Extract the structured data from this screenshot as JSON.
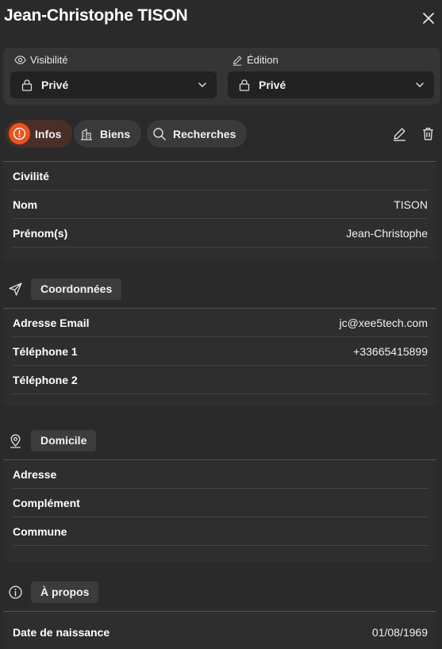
{
  "header": {
    "title": "Jean-Christophe TISON",
    "close_icon": "close-icon"
  },
  "visibility": {
    "visibilite_label": "Visibilité",
    "visibilite_value": "Privé",
    "edition_label": "Édition",
    "edition_value": "Privé"
  },
  "tabs": [
    {
      "label": "Infos",
      "icon": "info-icon",
      "active": true
    },
    {
      "label": "Biens",
      "icon": "building-icon",
      "active": false
    },
    {
      "label": "Recherches",
      "icon": "search-icon",
      "active": false
    }
  ],
  "identity": {
    "rows": [
      {
        "key": "Civilité",
        "value": ""
      },
      {
        "key": "Nom",
        "value": "TISON"
      },
      {
        "key": "Prénom(s)",
        "value": "Jean-Christophe"
      }
    ]
  },
  "coordonnees": {
    "title": "Coordonnées",
    "rows": [
      {
        "key": "Adresse Email",
        "value": "jc@xee5tech.com"
      },
      {
        "key": "Téléphone 1",
        "value": "+33665415899"
      },
      {
        "key": "Téléphone 2",
        "value": ""
      }
    ]
  },
  "domicile": {
    "title": "Domicile",
    "rows": [
      {
        "key": "Adresse",
        "value": ""
      },
      {
        "key": "Complément",
        "value": ""
      },
      {
        "key": "Commune",
        "value": ""
      }
    ]
  },
  "apropos": {
    "title": "À propos",
    "rows": [
      {
        "key": "Date de naissance",
        "value": "01/08/1969"
      }
    ]
  },
  "colors": {
    "accent": "#e8531f",
    "background": "#2a2a2a",
    "card": "#353535"
  }
}
